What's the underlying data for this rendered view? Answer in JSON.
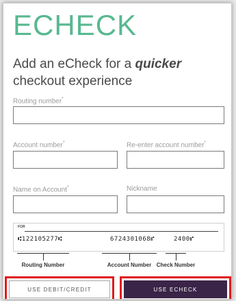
{
  "header": {
    "title": "ECHECK",
    "subtitle_prefix": "Add an eCheck for a ",
    "subtitle_emphasis": "quicker",
    "subtitle_suffix": " checkout experience"
  },
  "form": {
    "routing_label": "Routing number",
    "account_label": "Account number",
    "reenter_label": "Re-enter account number",
    "name_label": "Name on Account",
    "nickname_label": "Nickname",
    "required_mark": "*",
    "routing_value": "",
    "account_value": "",
    "reenter_value": "",
    "name_value": "",
    "nickname_value": ""
  },
  "check_diagram": {
    "for_label": "FOR",
    "routing_micr": "⑆122105277⑆",
    "account_micr": "6724301068⑈",
    "check_micr": "2400⑈",
    "routing_caption": "Routing Number",
    "account_caption": "Account Number",
    "check_caption": "Check Number"
  },
  "actions": {
    "debit_credit_label": "USE DEBIT/CREDIT",
    "echeck_label": "USE ECHECK"
  },
  "colors": {
    "title": "#58b890",
    "primary_button": "#3a2448",
    "highlight": "#e01a1a"
  }
}
